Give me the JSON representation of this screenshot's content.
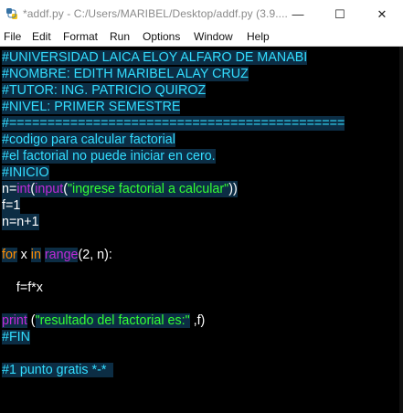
{
  "window": {
    "title": "*addf.py - C:/Users/MARIBEL/Desktop/addf.py (3.9....",
    "minimize": "—",
    "maximize": "☐",
    "close": "✕"
  },
  "menu": [
    "File",
    "Edit",
    "Format",
    "Run",
    "Options",
    "Window",
    "Help"
  ],
  "code": {
    "l1": "#UNIVERSIDAD LAICA ELOY ALFARO DE MANABI",
    "l2": "#NOMBRE: EDITH MARIBEL ALAY CRUZ",
    "l3": "#TUTOR: ING. PATRICIO QUIROZ",
    "l4": "#NIVEL: PRIMER SEMESTRE",
    "l5": "#============================================",
    "l6": "#codigo para calcular factorial",
    "l7": "#el factorial no puede iniciar en cero.",
    "l8": "#INICIO",
    "l9": {
      "a": "n=",
      "b": "int",
      "c": "(",
      "d": "input",
      "e": "(",
      "f": "\"ingrese factorial a calcular\"",
      "g": "))"
    },
    "l10": "f=1",
    "l11": "n=n+1",
    "l13": {
      "a": "for",
      "b": " x ",
      "c": "in",
      "d": " ",
      "e": "range",
      "f": "(2, n):"
    },
    "l15": "    f=f*x",
    "l17": {
      "a": "print",
      "b": " (",
      "c": "\"resultado del factorial es:\"",
      "d": " ,f)"
    },
    "l18": "#FIN",
    "l20": "#1 punto gratis *-*  "
  },
  "colors": {
    "background": "#000000",
    "comment": "#33ddff",
    "builtin": "#c02bd9",
    "keyword": "#ff8c00",
    "string": "#33ff33",
    "highlight": "#0c2d44"
  }
}
